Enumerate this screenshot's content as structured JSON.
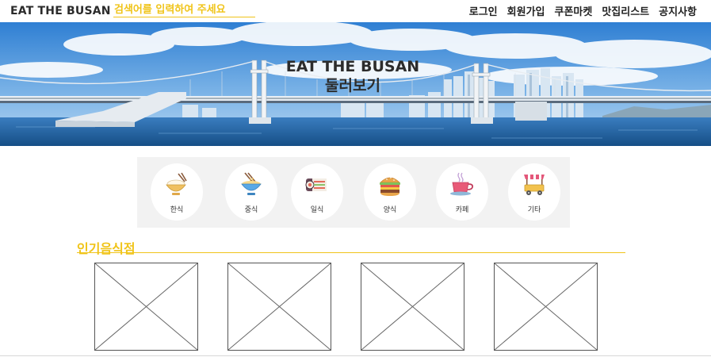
{
  "header": {
    "logo": "EAT THE BUSAN",
    "search_placeholder": "검색어를 입력하여 주세요",
    "nav": [
      "로그인",
      "회원가입",
      "쿠폰마켓",
      "맛집리스트",
      "공지사항"
    ]
  },
  "hero": {
    "title_line1": "EAT THE BUSAN",
    "title_line2": "둘러보기"
  },
  "categories": [
    {
      "label": "한식",
      "icon": "rice-bowl-icon"
    },
    {
      "label": "중식",
      "icon": "noodle-bowl-icon"
    },
    {
      "label": "일식",
      "icon": "sushi-roll-icon"
    },
    {
      "label": "양식",
      "icon": "burger-icon"
    },
    {
      "label": "카페",
      "icon": "coffee-cup-icon"
    },
    {
      "label": "기타",
      "icon": "food-cart-icon"
    }
  ],
  "popular": {
    "title": "인기음식점",
    "cards": 4
  },
  "colors": {
    "accent": "#f0c419",
    "sky": "#3f8ad6",
    "sea": "#1e5f9c",
    "category_bg": "#f2f2f2"
  }
}
